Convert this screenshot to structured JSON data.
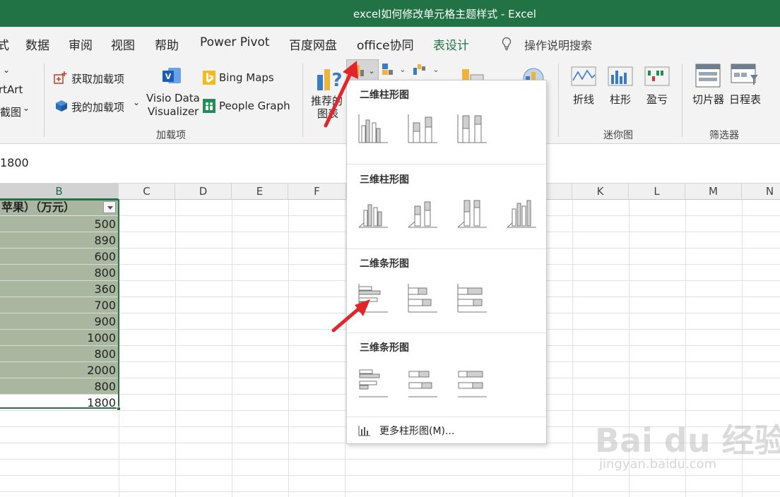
{
  "window": {
    "title": "excel如何修改单元格主题样式  -  Excel"
  },
  "tabs": [
    {
      "label": "式"
    },
    {
      "label": "数据"
    },
    {
      "label": "审阅"
    },
    {
      "label": "视图"
    },
    {
      "label": "帮助"
    },
    {
      "label": "Power Pivot"
    },
    {
      "label": "百度网盘"
    },
    {
      "label": "office协同"
    },
    {
      "label": "表设计"
    }
  ],
  "tellme": {
    "label": "操作说明搜索"
  },
  "ribbon": {
    "left_partial": {
      "smartart": "rtArt",
      "screenshot": "截图"
    },
    "addins": {
      "get_addins": "获取加载项",
      "my_addins": "我的加载项",
      "visio_line1": "Visio Data",
      "visio_line2": "Visualizer",
      "bing_maps": "Bing Maps",
      "people_graph": "People Graph",
      "group_label": "加载项"
    },
    "charts": {
      "recommended_line1": "推荐的",
      "recommended_line2": "图表"
    },
    "sparklines": {
      "line": "折线",
      "column": "柱形",
      "winloss": "盈亏",
      "group_label": "迷你图"
    },
    "filters": {
      "slicer": "切片器",
      "timeline": "日程表",
      "group_label": "筛选器"
    }
  },
  "formula_bar": {
    "value": "1800"
  },
  "columns": [
    "B",
    "C",
    "D",
    "E",
    "F",
    "K",
    "L",
    "M",
    "N"
  ],
  "table": {
    "header": "苹果）（万元）",
    "values": [
      "500",
      "890",
      "600",
      "800",
      "360",
      "700",
      "900",
      "1000",
      "800",
      "2000",
      "800",
      "1800"
    ]
  },
  "dropdown": {
    "sections": [
      {
        "title": "二维柱形图"
      },
      {
        "title": "三维柱形图"
      },
      {
        "title": "二维条形图"
      },
      {
        "title": "三维条形图"
      }
    ],
    "more": "更多柱形图(M)..."
  },
  "watermark": {
    "main": "Bai du 经验",
    "sub": "jingyan.baidu.com"
  },
  "colors": {
    "accent": "#217346",
    "table_fill": "#a9b7a0",
    "arrow": "#e0252b"
  }
}
